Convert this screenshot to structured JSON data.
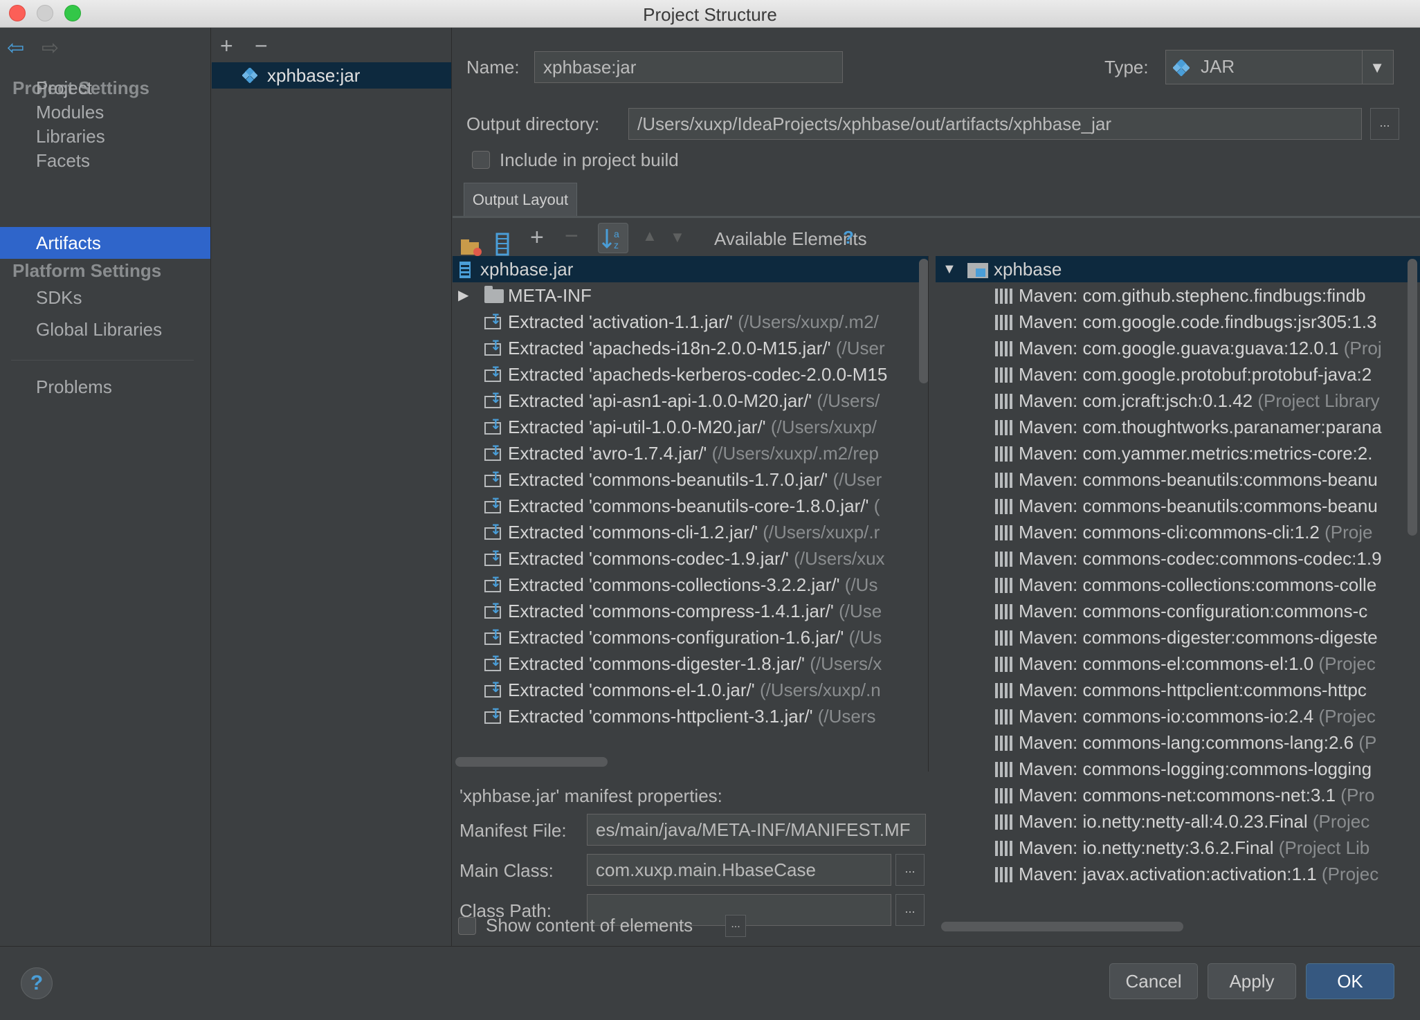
{
  "window": {
    "title": "Project Structure"
  },
  "nav": {
    "project_settings_header": "Project Settings",
    "platform_settings_header": "Platform Settings",
    "items": [
      {
        "label": "Project"
      },
      {
        "label": "Modules"
      },
      {
        "label": "Libraries"
      },
      {
        "label": "Facets"
      },
      {
        "label": "Artifacts",
        "selected": true
      }
    ],
    "platform_items": [
      {
        "label": "SDKs"
      },
      {
        "label": "Global Libraries"
      }
    ],
    "problems": "Problems"
  },
  "artifacts": {
    "add_label": "+",
    "remove_label": "−",
    "items": [
      {
        "label": "xphbase:jar",
        "icon": "artifact-diamond-icon"
      }
    ]
  },
  "form": {
    "name_label": "Name:",
    "name_value": "xphbase:jar",
    "type_label": "Type:",
    "type_value": "JAR",
    "output_dir_label": "Output directory:",
    "output_dir_value": "/Users/xuxp/IdeaProjects/xphbase/out/artifacts/xphbase_jar",
    "include_build_label": "Include in project build",
    "include_build_checked": false,
    "ellipsis": "..."
  },
  "tabs": [
    {
      "label": "Output Layout",
      "active": true
    }
  ],
  "layout_tree": {
    "root": "xphbase.jar",
    "folder": "META-INF",
    "items": [
      {
        "name": "Extracted 'activation-1.1.jar/'",
        "path": " (/Users/xuxp/.m2/"
      },
      {
        "name": "Extracted 'apacheds-i18n-2.0.0-M15.jar/'",
        "path": " (/User"
      },
      {
        "name": "Extracted 'apacheds-kerberos-codec-2.0.0-M15",
        "path": ""
      },
      {
        "name": "Extracted 'api-asn1-api-1.0.0-M20.jar/'",
        "path": " (/Users/"
      },
      {
        "name": "Extracted 'api-util-1.0.0-M20.jar/'",
        "path": " (/Users/xuxp/"
      },
      {
        "name": "Extracted 'avro-1.7.4.jar/'",
        "path": " (/Users/xuxp/.m2/rep"
      },
      {
        "name": "Extracted 'commons-beanutils-1.7.0.jar/'",
        "path": " (/User"
      },
      {
        "name": "Extracted 'commons-beanutils-core-1.8.0.jar/'",
        "path": " ("
      },
      {
        "name": "Extracted 'commons-cli-1.2.jar/'",
        "path": " (/Users/xuxp/.r"
      },
      {
        "name": "Extracted 'commons-codec-1.9.jar/'",
        "path": " (/Users/xux"
      },
      {
        "name": "Extracted 'commons-collections-3.2.2.jar/'",
        "path": " (/Us"
      },
      {
        "name": "Extracted 'commons-compress-1.4.1.jar/'",
        "path": " (/Use"
      },
      {
        "name": "Extracted 'commons-configuration-1.6.jar/'",
        "path": " (/Us"
      },
      {
        "name": "Extracted 'commons-digester-1.8.jar/'",
        "path": " (/Users/x"
      },
      {
        "name": "Extracted 'commons-el-1.0.jar/'",
        "path": " (/Users/xuxp/.n"
      },
      {
        "name": "Extracted 'commons-httpclient-3.1.jar/'",
        "path": " (/Users"
      }
    ]
  },
  "available": {
    "title": "Available Elements",
    "help": "?",
    "root": "xphbase",
    "items": [
      {
        "name": "Maven: com.github.stephenc.findbugs:findb",
        "hint": ""
      },
      {
        "name": "Maven: com.google.code.findbugs:jsr305:1.3",
        "hint": ""
      },
      {
        "name": "Maven: com.google.guava:guava:12.0.1",
        "hint": " (Proj"
      },
      {
        "name": "Maven: com.google.protobuf:protobuf-java:2",
        "hint": ""
      },
      {
        "name": "Maven: com.jcraft:jsch:0.1.42",
        "hint": " (Project Library"
      },
      {
        "name": "Maven: com.thoughtworks.paranamer:parana",
        "hint": ""
      },
      {
        "name": "Maven: com.yammer.metrics:metrics-core:2.",
        "hint": ""
      },
      {
        "name": "Maven: commons-beanutils:commons-beanu",
        "hint": ""
      },
      {
        "name": "Maven: commons-beanutils:commons-beanu",
        "hint": ""
      },
      {
        "name": "Maven: commons-cli:commons-cli:1.2",
        "hint": " (Proje"
      },
      {
        "name": "Maven: commons-codec:commons-codec:1.9",
        "hint": ""
      },
      {
        "name": "Maven: commons-collections:commons-colle",
        "hint": ""
      },
      {
        "name": "Maven: commons-configuration:commons-c",
        "hint": ""
      },
      {
        "name": "Maven: commons-digester:commons-digeste",
        "hint": ""
      },
      {
        "name": "Maven: commons-el:commons-el:1.0",
        "hint": " (Projec"
      },
      {
        "name": "Maven: commons-httpclient:commons-httpc",
        "hint": ""
      },
      {
        "name": "Maven: commons-io:commons-io:2.4",
        "hint": " (Projec"
      },
      {
        "name": "Maven: commons-lang:commons-lang:2.6",
        "hint": " (P"
      },
      {
        "name": "Maven: commons-logging:commons-logging",
        "hint": ""
      },
      {
        "name": "Maven: commons-net:commons-net:3.1",
        "hint": " (Pro"
      },
      {
        "name": "Maven: io.netty:netty-all:4.0.23.Final",
        "hint": " (Projec"
      },
      {
        "name": "Maven: io.netty:netty:3.6.2.Final",
        "hint": " (Project Lib"
      },
      {
        "name": "Maven: javax.activation:activation:1.1",
        "hint": " (Projec"
      }
    ]
  },
  "manifest": {
    "title": "'xphbase.jar' manifest properties:",
    "file_label": "Manifest File:",
    "file_value": "es/main/java/META-INF/MANIFEST.MF",
    "main_class_label": "Main Class:",
    "main_class_value": "com.xuxp.main.HbaseCase",
    "class_path_label": "Class Path:",
    "class_path_value": "",
    "show_content_label": "Show content of elements",
    "show_content_checked": false
  },
  "buttons": {
    "help": "?",
    "cancel": "Cancel",
    "apply": "Apply",
    "ok": "OK"
  },
  "colors": {
    "accent": "#2f65ca",
    "selection": "#0d293e",
    "background": "#3c3f41",
    "link_blue": "#4a9ed8"
  }
}
